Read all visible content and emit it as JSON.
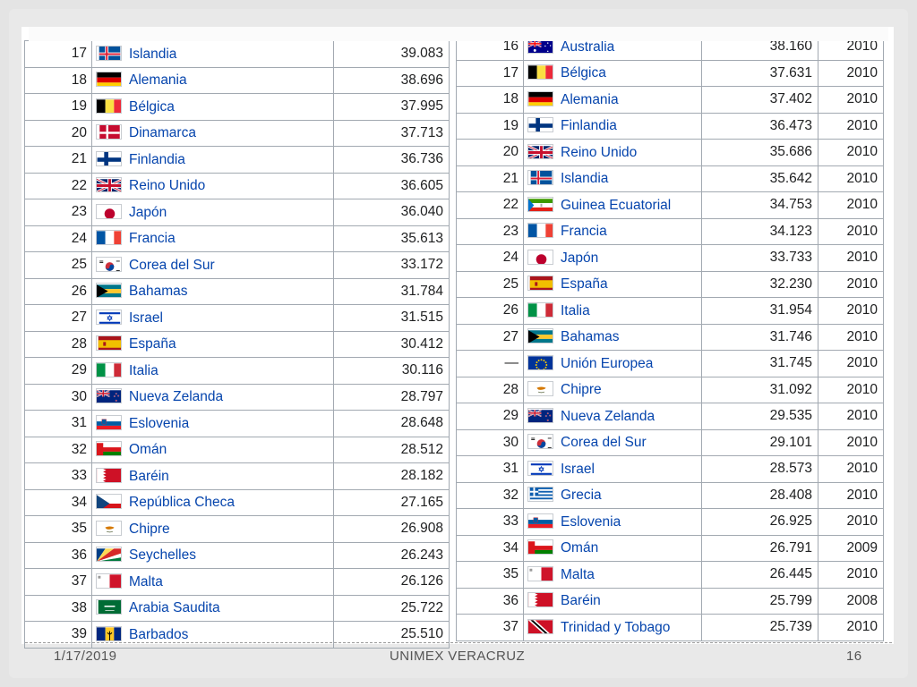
{
  "left_table": [
    {
      "rank": "17",
      "country": "Islandia",
      "value": "39.083",
      "flag": "iceland"
    },
    {
      "rank": "18",
      "country": "Alemania",
      "value": "38.696",
      "flag": "germany"
    },
    {
      "rank": "19",
      "country": "Bélgica",
      "value": "37.995",
      "flag": "belgium"
    },
    {
      "rank": "20",
      "country": "Dinamarca",
      "value": "37.713",
      "flag": "denmark"
    },
    {
      "rank": "21",
      "country": "Finlandia",
      "value": "36.736",
      "flag": "finland"
    },
    {
      "rank": "22",
      "country": "Reino Unido",
      "value": "36.605",
      "flag": "uk"
    },
    {
      "rank": "23",
      "country": "Japón",
      "value": "36.040",
      "flag": "japan"
    },
    {
      "rank": "24",
      "country": "Francia",
      "value": "35.613",
      "flag": "france"
    },
    {
      "rank": "25",
      "country": "Corea del Sur",
      "value": "33.172",
      "flag": "south-korea"
    },
    {
      "rank": "26",
      "country": "Bahamas",
      "value": "31.784",
      "flag": "bahamas"
    },
    {
      "rank": "27",
      "country": "Israel",
      "value": "31.515",
      "flag": "israel"
    },
    {
      "rank": "28",
      "country": "España",
      "value": "30.412",
      "flag": "spain"
    },
    {
      "rank": "29",
      "country": "Italia",
      "value": "30.116",
      "flag": "italy"
    },
    {
      "rank": "30",
      "country": "Nueva Zelanda",
      "value": "28.797",
      "flag": "new-zealand"
    },
    {
      "rank": "31",
      "country": "Eslovenia",
      "value": "28.648",
      "flag": "slovenia"
    },
    {
      "rank": "32",
      "country": "Omán",
      "value": "28.512",
      "flag": "oman"
    },
    {
      "rank": "33",
      "country": "Baréin",
      "value": "28.182",
      "flag": "bahrain"
    },
    {
      "rank": "34",
      "country": "República Checa",
      "value": "27.165",
      "flag": "czech"
    },
    {
      "rank": "35",
      "country": "Chipre",
      "value": "26.908",
      "flag": "cyprus"
    },
    {
      "rank": "36",
      "country": "Seychelles",
      "value": "26.243",
      "flag": "seychelles"
    },
    {
      "rank": "37",
      "country": "Malta",
      "value": "26.126",
      "flag": "malta"
    },
    {
      "rank": "38",
      "country": "Arabia Saudita",
      "value": "25.722",
      "flag": "saudi"
    },
    {
      "rank": "39",
      "country": "Barbados",
      "value": "25.510",
      "flag": "barbados"
    }
  ],
  "right_table": [
    {
      "rank": "16",
      "country": "Australia",
      "value": "38.160",
      "year": "2010",
      "flag": "australia"
    },
    {
      "rank": "17",
      "country": "Bélgica",
      "value": "37.631",
      "year": "2010",
      "flag": "belgium"
    },
    {
      "rank": "18",
      "country": "Alemania",
      "value": "37.402",
      "year": "2010",
      "flag": "germany"
    },
    {
      "rank": "19",
      "country": "Finlandia",
      "value": "36.473",
      "year": "2010",
      "flag": "finland"
    },
    {
      "rank": "20",
      "country": "Reino Unido",
      "value": "35.686",
      "year": "2010",
      "flag": "uk"
    },
    {
      "rank": "21",
      "country": "Islandia",
      "value": "35.642",
      "year": "2010",
      "flag": "iceland"
    },
    {
      "rank": "22",
      "country": "Guinea Ecuatorial",
      "value": "34.753",
      "year": "2010",
      "flag": "eq-guinea"
    },
    {
      "rank": "23",
      "country": "Francia",
      "value": "34.123",
      "year": "2010",
      "flag": "france"
    },
    {
      "rank": "24",
      "country": "Japón",
      "value": "33.733",
      "year": "2010",
      "flag": "japan"
    },
    {
      "rank": "25",
      "country": "España",
      "value": "32.230",
      "year": "2010",
      "flag": "spain"
    },
    {
      "rank": "26",
      "country": "Italia",
      "value": "31.954",
      "year": "2010",
      "flag": "italy"
    },
    {
      "rank": "27",
      "country": "Bahamas",
      "value": "31.746",
      "year": "2010",
      "flag": "bahamas"
    },
    {
      "rank": "—",
      "country": "Unión Europea",
      "value": "31.745",
      "year": "2010",
      "flag": "eu"
    },
    {
      "rank": "28",
      "country": "Chipre",
      "value": "31.092",
      "year": "2010",
      "flag": "cyprus"
    },
    {
      "rank": "29",
      "country": "Nueva Zelanda",
      "value": "29.535",
      "year": "2010",
      "flag": "new-zealand"
    },
    {
      "rank": "30",
      "country": "Corea del Sur",
      "value": "29.101",
      "year": "2010",
      "flag": "south-korea"
    },
    {
      "rank": "31",
      "country": "Israel",
      "value": "28.573",
      "year": "2010",
      "flag": "israel"
    },
    {
      "rank": "32",
      "country": "Grecia",
      "value": "28.408",
      "year": "2010",
      "flag": "greece"
    },
    {
      "rank": "33",
      "country": "Eslovenia",
      "value": "26.925",
      "year": "2010",
      "flag": "slovenia"
    },
    {
      "rank": "34",
      "country": "Omán",
      "value": "26.791",
      "year": "2009",
      "flag": "oman"
    },
    {
      "rank": "35",
      "country": "Malta",
      "value": "26.445",
      "year": "2010",
      "flag": "malta"
    },
    {
      "rank": "36",
      "country": "Baréin",
      "value": "25.799",
      "year": "2008",
      "flag": "bahrain"
    },
    {
      "rank": "37",
      "country": "Trinidad y Tobago",
      "value": "25.739",
      "year": "2010",
      "flag": "trinidad"
    }
  ],
  "footer": {
    "date": "1/17/2019",
    "center": "UNIMEX VERACRUZ",
    "page": "16"
  },
  "colors": {
    "link": "#0645ad",
    "border": "#a2a9b1",
    "text": "#202122",
    "footer_text": "#555555"
  }
}
